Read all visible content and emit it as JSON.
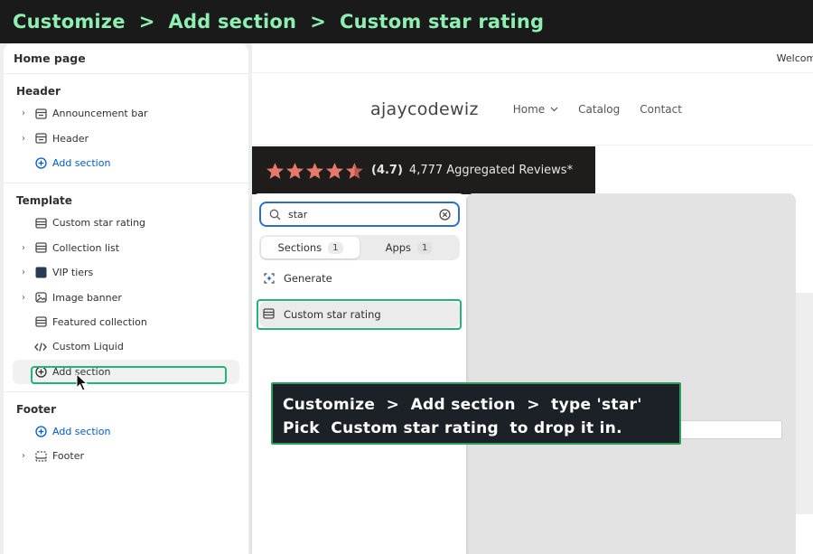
{
  "banner": {
    "crumbs": [
      "Customize",
      "Add section",
      "Custom star rating"
    ],
    "separator": ">"
  },
  "sidebar": {
    "title": "Home page",
    "header_group": {
      "title": "Header",
      "items": [
        {
          "label": "Announcement bar",
          "icon": "section-icon"
        },
        {
          "label": "Header",
          "icon": "section-icon"
        }
      ],
      "add_label": "Add section"
    },
    "template_group": {
      "title": "Template",
      "items": [
        {
          "label": "Custom star rating",
          "icon": "section-icon"
        },
        {
          "label": "Collection list",
          "icon": "section-icon"
        },
        {
          "label": "VIP tiers",
          "icon": "app-block-icon"
        },
        {
          "label": "Image banner",
          "icon": "image-icon"
        },
        {
          "label": "Featured collection",
          "icon": "section-icon"
        },
        {
          "label": "Custom Liquid",
          "icon": "code-icon"
        }
      ],
      "add_label": "Add section"
    },
    "footer_group": {
      "title": "Footer",
      "add_label": "Add section",
      "items": [
        {
          "label": "Footer",
          "icon": "footer-icon"
        }
      ]
    }
  },
  "preview": {
    "announcement": "Welcome",
    "store_name": "ajaycodewiz",
    "nav": [
      {
        "label": "Home",
        "has_dropdown": true
      },
      {
        "label": "Catalog"
      },
      {
        "label": "Contact"
      }
    ],
    "rating": {
      "stars": 4.5,
      "score": "(4.7)",
      "text": "4,777 Aggregated Reviews*",
      "star_color": "#e7796a"
    }
  },
  "popover": {
    "search_value": "star",
    "tabs": [
      {
        "label": "Sections",
        "count": "1"
      },
      {
        "label": "Apps",
        "count": "1"
      }
    ],
    "generate_label": "Generate",
    "result_label": "Custom star rating"
  },
  "tooltip": {
    "line1": "Customize  >  Add section  >  type 'star'",
    "line2": "Pick  Custom star rating  to drop it in."
  },
  "colors": {
    "accent": "#005bd3",
    "highlight": "#22b573",
    "banner_text": "#8df0b2"
  }
}
